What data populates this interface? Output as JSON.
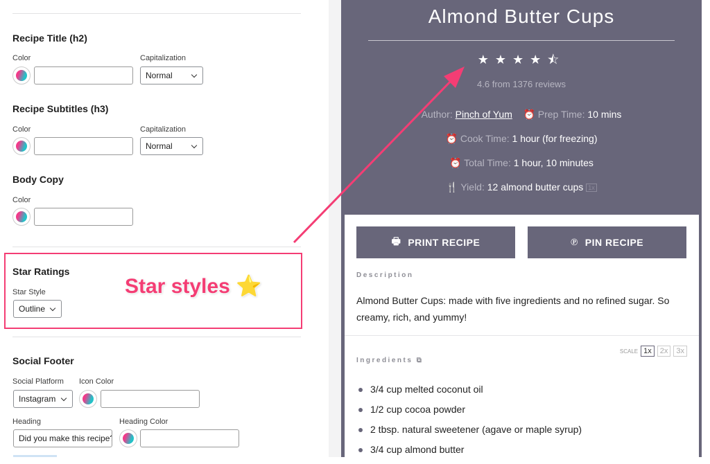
{
  "settings": {
    "recipe_title": {
      "heading": "Recipe Title (h2)",
      "color_label": "Color",
      "color_value": "",
      "cap_label": "Capitalization",
      "cap_value": "Normal"
    },
    "recipe_subtitles": {
      "heading": "Recipe Subtitles (h3)",
      "color_label": "Color",
      "color_value": "",
      "cap_label": "Capitalization",
      "cap_value": "Normal"
    },
    "body_copy": {
      "heading": "Body Copy",
      "color_label": "Color",
      "color_value": ""
    },
    "star_ratings": {
      "heading": "Star Ratings",
      "style_label": "Star Style",
      "style_value": "Outline"
    },
    "social_footer": {
      "heading": "Social Footer",
      "platform_label": "Social Platform",
      "platform_value": "Instagram",
      "icon_color_label": "Icon Color",
      "heading_label": "Heading",
      "heading_value": "Did you make this recipe?",
      "heading_color_label": "Heading Color"
    }
  },
  "annotation": {
    "text": "Star styles ⭐",
    "color": "#f43d74"
  },
  "recipe": {
    "title": "Almond Butter Cups",
    "rating": 4.6,
    "stars": "★★★★⯪",
    "rating_text": "4.6 from 1376 reviews",
    "author_label": "Author:",
    "author": "Pinch of Yum",
    "prep_label": "Prep Time:",
    "prep": "10 mins",
    "cook_label": "Cook Time:",
    "cook": "1 hour (for freezing)",
    "total_label": "Total Time:",
    "total": "1 hour, 10 minutes",
    "yield_label": "Yield:",
    "yield": "12 almond butter cups",
    "yield_badge": "1x",
    "print_label": "PRINT RECIPE",
    "pin_label": "PIN RECIPE",
    "description_heading": "Description",
    "description": "Almond Butter Cups: made with five ingredients and no refined sugar. So creamy, rich, and yummy!",
    "ingredients_heading": "Ingredients",
    "scale_label": "SCALE",
    "scale_options": [
      "1x",
      "2x",
      "3x"
    ],
    "scale_selected": "1x",
    "ingredients": [
      "3/4 cup melted coconut oil",
      "1/2 cup cocoa powder",
      "2 tbsp. natural sweetener (agave or maple syrup)",
      "3/4 cup almond butter"
    ],
    "theme_color": "#68667a"
  }
}
